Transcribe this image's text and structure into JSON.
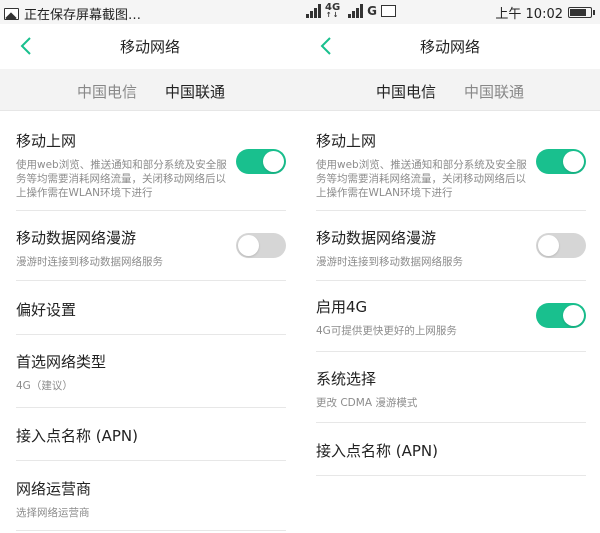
{
  "status_bar": {
    "notification_text": "正在保存屏幕截图…",
    "network_1": "4G",
    "network_2": "G",
    "time": "上午 10:02"
  },
  "left_screen": {
    "title": "移动网络",
    "tabs": [
      {
        "label": "中国电信",
        "active": false
      },
      {
        "label": "中国联通",
        "active": true
      }
    ],
    "settings": [
      {
        "title": "移动上网",
        "subtitle": "使用web浏览、推送通知和部分系统及安全服务等均需要消耗网络流量，关闭移动网络后以上操作需在WLAN环境下进行",
        "toggle": true
      },
      {
        "title": "移动数据网络漫游",
        "subtitle": "漫游时连接到移动数据网络服务",
        "toggle": false
      },
      {
        "title": "偏好设置"
      },
      {
        "title": "首选网络类型",
        "subtitle": "4G（建议）"
      },
      {
        "title": "接入点名称 (APN)"
      },
      {
        "title": "网络运营商",
        "subtitle": "选择网络运营商"
      }
    ]
  },
  "right_screen": {
    "title": "移动网络",
    "tabs": [
      {
        "label": "中国电信",
        "active": true
      },
      {
        "label": "中国联通",
        "active": false
      }
    ],
    "settings": [
      {
        "title": "移动上网",
        "subtitle": "使用web浏览、推送通知和部分系统及安全服务等均需要消耗网络流量，关闭移动网络后以上操作需在WLAN环境下进行",
        "toggle": true
      },
      {
        "title": "移动数据网络漫游",
        "subtitle": "漫游时连接到移动数据网络服务",
        "toggle": false
      },
      {
        "title": "启用4G",
        "subtitle": "4G可提供更快更好的上网服务",
        "toggle": true
      },
      {
        "title": "系统选择",
        "subtitle": "更改 CDMA 漫游模式"
      },
      {
        "title": "接入点名称 (APN)"
      }
    ]
  },
  "colors": {
    "accent": "#19c08e",
    "toggle_off": "#d6d6d6",
    "tab_bar": "#f3f3f3"
  },
  "icons": [
    "image-icon",
    "signal-icon",
    "battery-icon",
    "back-arrow-icon"
  ]
}
